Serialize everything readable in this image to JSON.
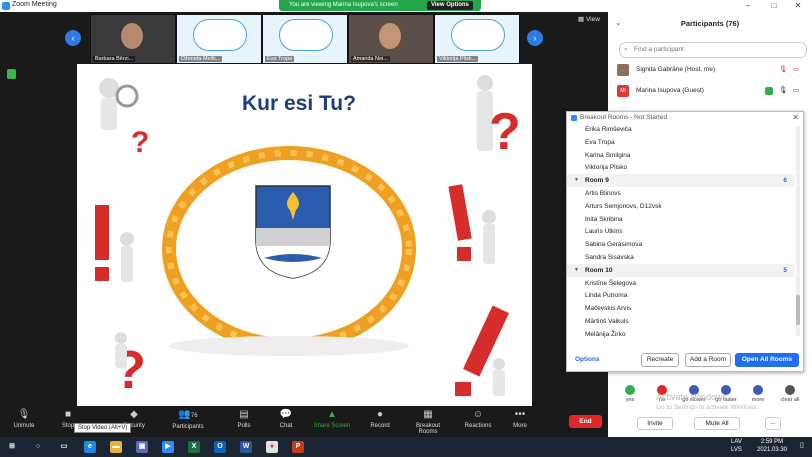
{
  "window": {
    "title": "Zoom Meeting"
  },
  "share_banner": {
    "message": "You are viewing Marina Isupova's screen",
    "view_options": "View Options"
  },
  "strip": {
    "view_label": "View",
    "participants": [
      {
        "name": "Barbara Bērzi..."
      },
      {
        "name": "Dženeta Melik..."
      },
      {
        "name": "Eva Tropa"
      },
      {
        "name": "Amanda Nei..."
      },
      {
        "name": "Viktorija Plisk..."
      }
    ]
  },
  "slide": {
    "title": "Kur esi Tu?"
  },
  "toolbar": {
    "unmute": "Unmute",
    "stop_video": "Stop",
    "security": "Security",
    "participants": "Participants",
    "participants_count": "76",
    "polls": "Polls",
    "chat": "Chat",
    "share_screen": "Share Screen",
    "record": "Record",
    "breakout_rooms": "Breakout Rooms",
    "reactions": "Reactions",
    "more": "More",
    "end": "End",
    "tooltip": "Stop Video (Alt+V)"
  },
  "panel": {
    "title": "Participants (76)",
    "search_placeholder": "Find a participant",
    "rows": [
      {
        "name": "Signita Gabrāne (Host, me)",
        "avatar_color": "#8a6f5a"
      },
      {
        "name": "Marina Isupova (Guest)",
        "avatar_color": "#d9393f",
        "initials": "MI"
      }
    ],
    "invite": "Invite",
    "mute_all": "Mute All",
    "more": "..."
  },
  "breakout": {
    "title": "Breakout Rooms - Not Started",
    "rows": [
      {
        "type": "member",
        "text": "Erika Rimševiča"
      },
      {
        "type": "member",
        "text": "Eva Tropa"
      },
      {
        "type": "member",
        "text": "Karina Smilgina"
      },
      {
        "type": "member",
        "text": "Viktorija Plisko"
      },
      {
        "type": "room",
        "text": "Room 9",
        "count": "6"
      },
      {
        "type": "member",
        "text": "Artis Bļinovs"
      },
      {
        "type": "member",
        "text": "Arturs Semjonovs, D12vsk"
      },
      {
        "type": "member",
        "text": "Inita Skribina"
      },
      {
        "type": "member",
        "text": "Lauris Utkins"
      },
      {
        "type": "member",
        "text": "Sabina Gerasimova"
      },
      {
        "type": "member",
        "text": "Sandra Sisavska"
      },
      {
        "type": "room",
        "text": "Room 10",
        "count": "5"
      },
      {
        "type": "member",
        "text": "Kristīne Šelegova"
      },
      {
        "type": "member",
        "text": "Linda Putroma"
      },
      {
        "type": "member",
        "text": "Mačevskis Arvis"
      },
      {
        "type": "member",
        "text": "Mārtiņš Vaikuls"
      },
      {
        "type": "member",
        "text": "Melānija Žirko"
      }
    ],
    "options": "Options",
    "recreate": "Recreate",
    "add_room": "Add a Room",
    "open_all": "Open All Rooms"
  },
  "reactions": [
    {
      "label": "yes",
      "color": "#2cae4a"
    },
    {
      "label": "no",
      "color": "#e02828"
    },
    {
      "label": "go slower",
      "color": "#3b5bb5"
    },
    {
      "label": "go faster",
      "color": "#3b5bb5"
    },
    {
      "label": "more",
      "color": "#3b5bb5"
    },
    {
      "label": "clear all",
      "color": "#555555"
    }
  ],
  "activate": {
    "line1": "Activate Windows",
    "line2": "Go to Settings to activate Windows."
  },
  "taskbar": {
    "lang1": "LAV",
    "lang2": "LVS",
    "time": "2:59 PM",
    "date": "2021.03.30"
  }
}
